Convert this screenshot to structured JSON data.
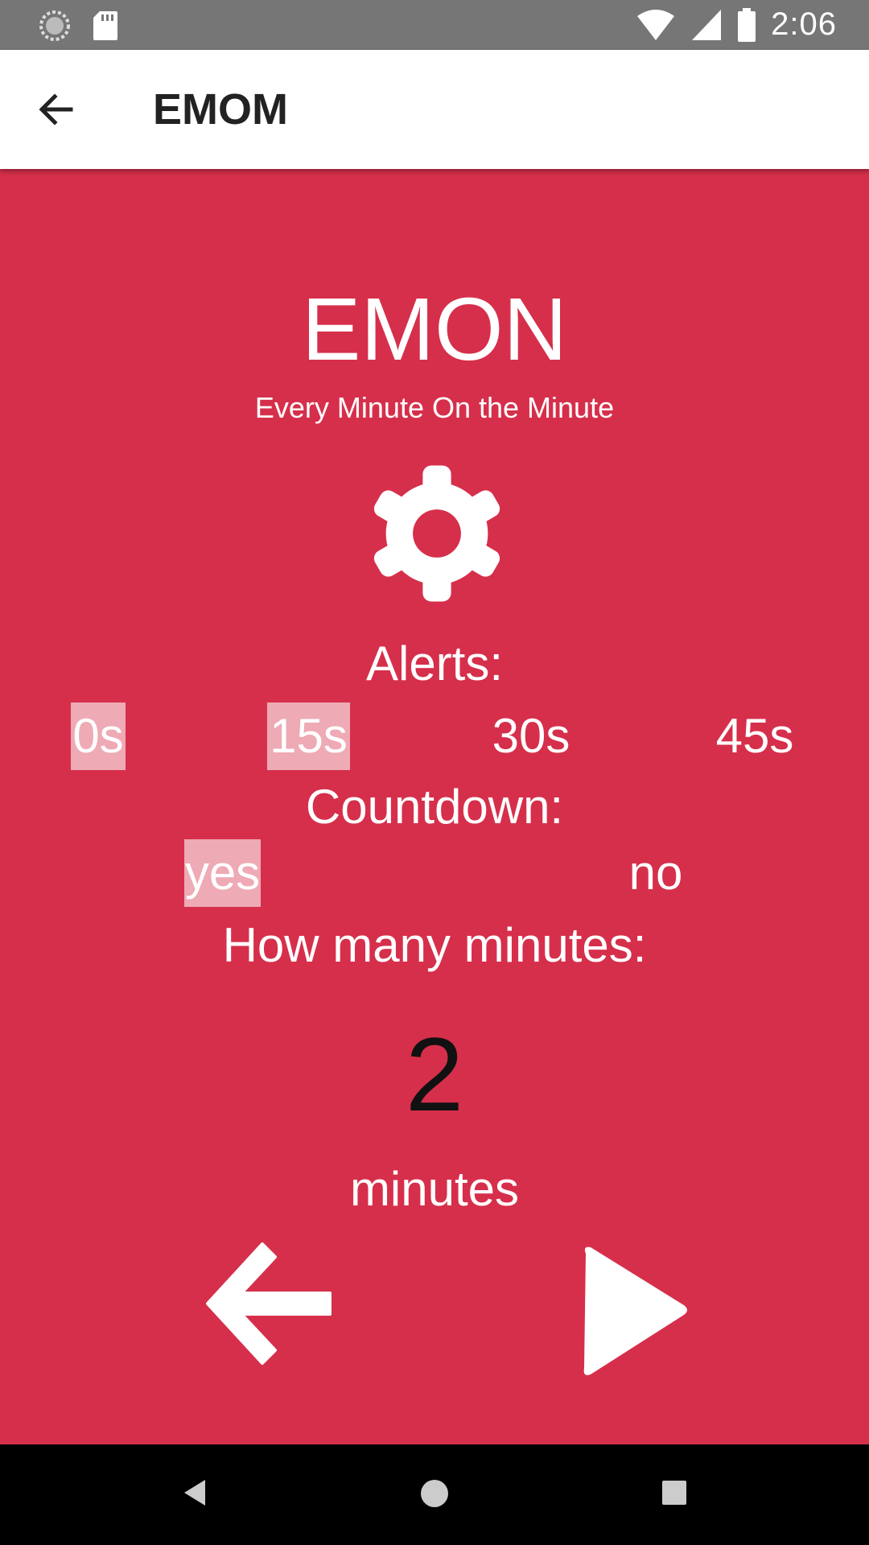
{
  "status_bar": {
    "time": "2:06",
    "icons": [
      "sync-icon",
      "sd-card-icon",
      "wifi-icon",
      "signal-icon",
      "battery-icon"
    ]
  },
  "app_bar": {
    "title": "EMOM",
    "back_icon": "back-arrow-icon"
  },
  "main": {
    "title": "EMON",
    "subtitle": "Every Minute On the Minute",
    "settings_icon": "gear-icon",
    "alerts": {
      "label": "Alerts:",
      "options": [
        "0s",
        "15s",
        "30s",
        "45s"
      ],
      "selected": [
        "0s",
        "15s"
      ]
    },
    "countdown": {
      "label": "Countdown:",
      "options": [
        "yes",
        "no"
      ],
      "selected": "yes"
    },
    "minutes": {
      "label": "How many minutes:",
      "value": "2",
      "unit": "minutes"
    },
    "buttons": {
      "back_icon": "left-arrow-icon",
      "start_icon": "play-icon"
    }
  },
  "nav_bar": {
    "icons": [
      "nav-back-icon",
      "nav-home-icon",
      "nav-recents-icon"
    ]
  },
  "colors": {
    "background": "#d62f4b",
    "selected_chip": "#eeaab5",
    "status_bar": "#767676"
  }
}
